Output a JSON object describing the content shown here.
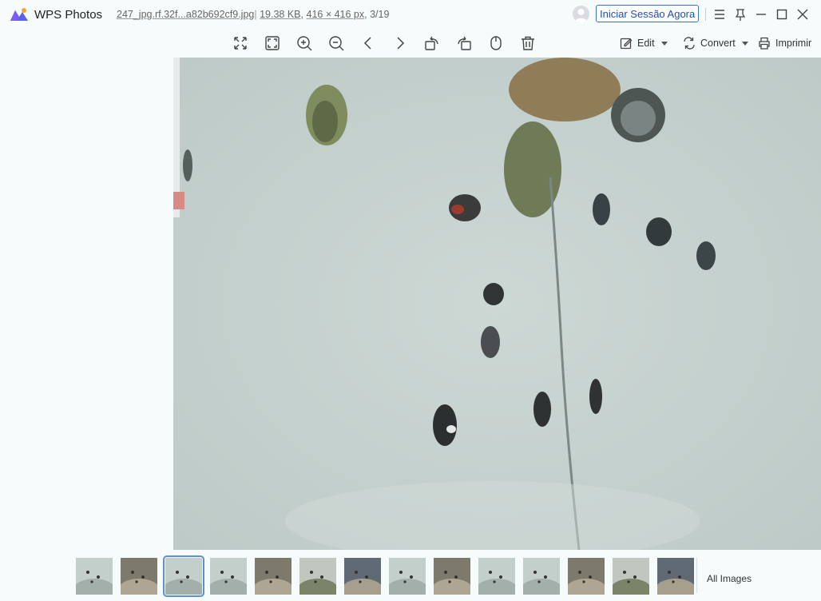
{
  "app": {
    "title": "WPS Photos"
  },
  "file": {
    "name": "247_jpg.rf.32f...a82b692cf9.jpg",
    "size": "19.38 KB",
    "dimensions": "416 × 416 px",
    "position": "3/19",
    "separator": ","
  },
  "header": {
    "login_label": "Iniciar Sessão Agora"
  },
  "toolbar": {
    "icons": [
      "fit-screen-icon",
      "fullscreen-icon",
      "zoom-in-icon",
      "zoom-out-icon",
      "previous-icon",
      "next-icon",
      "rotate-left-icon",
      "rotate-right-icon",
      "mouse-icon",
      "delete-icon"
    ],
    "edit_label": "Edit",
    "convert_label": "Convert",
    "print_label": "Imprimir"
  },
  "filmstrip": {
    "selected_index": 2,
    "count_visible": 14,
    "all_images_label": "All Images"
  },
  "colors": {
    "accent": "#3b6fd8",
    "background": "#f6fbfb",
    "pavement": "#c9d6d3"
  }
}
